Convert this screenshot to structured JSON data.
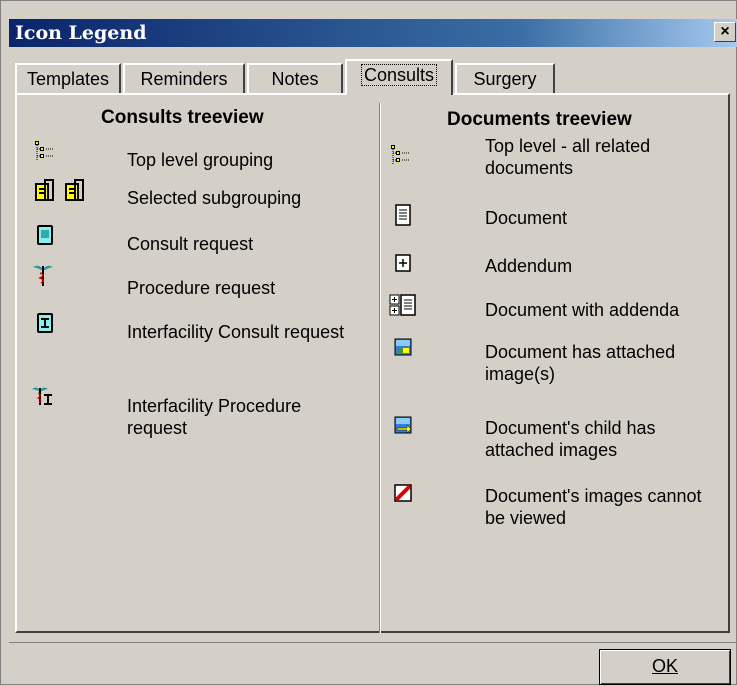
{
  "window": {
    "title": "Icon Legend",
    "close_label": "×"
  },
  "tabs": [
    {
      "label": "Templates",
      "active": false
    },
    {
      "label": "Reminders",
      "active": false
    },
    {
      "label": "Notes",
      "active": false
    },
    {
      "label": "Consults",
      "active": true
    },
    {
      "label": "Surgery",
      "active": false
    }
  ],
  "consults": {
    "heading": "Consults treeview",
    "items": [
      {
        "icon": "tree-grouping-icon",
        "label": "Top level grouping"
      },
      {
        "icon": "folder-pair-icon",
        "label": "Selected subgrouping"
      },
      {
        "icon": "consult-request-icon",
        "label": "Consult request"
      },
      {
        "icon": "caduceus-icon",
        "label": "Procedure request"
      },
      {
        "icon": "interfacility-consult-icon",
        "label": "Interfacility Consult request"
      },
      {
        "icon": "interfacility-procedure-icon",
        "label": "Interfacility Procedure request"
      }
    ]
  },
  "documents": {
    "heading": "Documents treeview",
    "items": [
      {
        "icon": "tree-grouping-icon",
        "label": "Top level - all related documents"
      },
      {
        "icon": "document-icon",
        "label": "Document"
      },
      {
        "icon": "addendum-icon",
        "label": "Addendum"
      },
      {
        "icon": "document-addenda-icon",
        "label": "Document with addenda"
      },
      {
        "icon": "attached-image-icon",
        "label": "Document has attached image(s)"
      },
      {
        "icon": "child-image-icon",
        "label": "Document's child has attached images"
      },
      {
        "icon": "image-unviewable-icon",
        "label": "Document's images cannot be viewed"
      }
    ]
  },
  "footer": {
    "ok_label": "OK"
  }
}
